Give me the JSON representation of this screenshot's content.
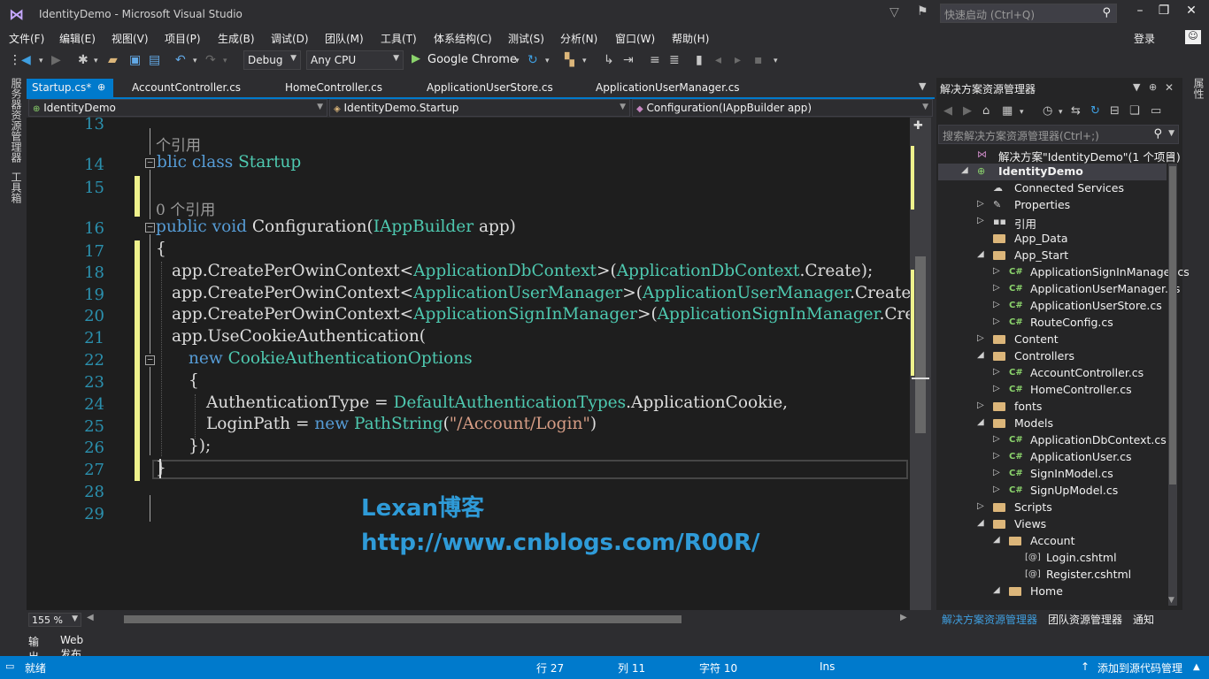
{
  "window": {
    "title": "IdentityDemo - Microsoft Visual Studio",
    "quick_launch_placeholder": "快速启动 (Ctrl+Q)",
    "login": "登录"
  },
  "menu": [
    "文件(F)",
    "编辑(E)",
    "视图(V)",
    "项目(P)",
    "生成(B)",
    "调试(D)",
    "团队(M)",
    "工具(T)",
    "体系结构(C)",
    "测试(S)",
    "分析(N)",
    "窗口(W)",
    "帮助(H)"
  ],
  "toolbar": {
    "config": "Debug",
    "platform": "Any CPU",
    "run_target": "Google Chrome"
  },
  "left_strip": {
    "server_explorer": "服务器资源管理器",
    "toolbox": "工具箱"
  },
  "right_strip": {
    "properties": "属性"
  },
  "tabs": [
    {
      "label": "Startup.cs*",
      "active": true
    },
    {
      "label": "AccountController.cs"
    },
    {
      "label": "HomeController.cs"
    },
    {
      "label": "ApplicationUserStore.cs"
    },
    {
      "label": "ApplicationUserManager.cs"
    }
  ],
  "navbar": {
    "project": "IdentityDemo",
    "type": "IdentityDemo.Startup",
    "member": "Configuration(IAppBuilder app)"
  },
  "code": {
    "line_numbers": [
      "13",
      "14",
      "15",
      "16",
      "17",
      "18",
      "19",
      "20",
      "21",
      "22",
      "23",
      "24",
      "25",
      "26",
      "27",
      "28",
      "29"
    ],
    "refs_a": "个引用",
    "refs_b": "0 个引用",
    "l14_kw": "blic class ",
    "l14_ty": "Startup",
    "l16_kw": "public void ",
    "l16_a": "Configuration(",
    "l16_ty": "IAppBuilder",
    "l16_b": " app)",
    "l17": "{",
    "l18_a": "app.CreatePerOwinContext<",
    "l18_t1": "ApplicationDbContext",
    "l18_b": ">(",
    "l18_t2": "ApplicationDbContext",
    "l18_c": ".Create);",
    "l19_a": "app.CreatePerOwinContext<",
    "l19_t1": "ApplicationUserManager",
    "l19_b": ">(",
    "l19_t2": "ApplicationUserManager",
    "l19_c": ".Create);",
    "l20_a": "app.CreatePerOwinContext<",
    "l20_t1": "ApplicationSignInManager",
    "l20_b": ">(",
    "l20_t2": "ApplicationSignInManager",
    "l20_c": ".Create);",
    "l21": "app.UseCookieAuthentication(",
    "l22_kw": "new ",
    "l22_ty": "CookieAuthenticationOptions",
    "l23": "{",
    "l24_a": "AuthenticationType = ",
    "l24_ty": "DefaultAuthenticationTypes",
    "l24_b": ".ApplicationCookie,",
    "l25_a": "LoginPath = ",
    "l25_kw": "new ",
    "l25_ty": "PathString",
    "l25_b": "(",
    "l25_st": "\"/Account/Login\"",
    "l25_c": ")",
    "l26": "});",
    "l27": "}"
  },
  "watermark": {
    "line1": "Lexan博客",
    "line2": "http://www.cnblogs.com/R00R/"
  },
  "zoom": "155 %",
  "bottom_tabs": [
    "输出",
    "Web 发布活动"
  ],
  "status": {
    "ready": "就绪",
    "row": "行 27",
    "col": "列 11",
    "char": "字符 10",
    "ins": "Ins",
    "source_control": "添加到源代码管理"
  },
  "solution_explorer": {
    "title": "解决方案资源管理器",
    "search_placeholder": "搜索解决方案资源管理器(Ctrl+;)",
    "tree": [
      {
        "label": "解决方案\"IdentityDemo\"(1 个项目)",
        "level": 0,
        "icon": "solution",
        "exp": ""
      },
      {
        "label": "IdentityDemo",
        "level": 0,
        "icon": "project",
        "exp": "▲",
        "bold": true,
        "sel": true
      },
      {
        "label": "Connected Services",
        "level": 1,
        "icon": "connected",
        "exp": ""
      },
      {
        "label": "Properties",
        "level": 1,
        "icon": "wrench",
        "exp": "▷"
      },
      {
        "label": "引用",
        "level": 1,
        "icon": "refs",
        "exp": "▷"
      },
      {
        "label": "App_Data",
        "level": 1,
        "icon": "folder",
        "exp": ""
      },
      {
        "label": "App_Start",
        "level": 1,
        "icon": "folder",
        "exp": "▲"
      },
      {
        "label": "ApplicationSignInManager.cs",
        "level": 2,
        "icon": "cs",
        "exp": "▷"
      },
      {
        "label": "ApplicationUserManager.cs",
        "level": 2,
        "icon": "cs",
        "exp": "▷"
      },
      {
        "label": "ApplicationUserStore.cs",
        "level": 2,
        "icon": "cs",
        "exp": "▷"
      },
      {
        "label": "RouteConfig.cs",
        "level": 2,
        "icon": "cs",
        "exp": "▷"
      },
      {
        "label": "Content",
        "level": 1,
        "icon": "folder",
        "exp": "▷"
      },
      {
        "label": "Controllers",
        "level": 1,
        "icon": "folder",
        "exp": "▲"
      },
      {
        "label": "AccountController.cs",
        "level": 2,
        "icon": "cs",
        "exp": "▷"
      },
      {
        "label": "HomeController.cs",
        "level": 2,
        "icon": "cs",
        "exp": "▷"
      },
      {
        "label": "fonts",
        "level": 1,
        "icon": "folder",
        "exp": "▷"
      },
      {
        "label": "Models",
        "level": 1,
        "icon": "folder",
        "exp": "▲"
      },
      {
        "label": "ApplicationDbContext.cs",
        "level": 2,
        "icon": "cs",
        "exp": "▷"
      },
      {
        "label": "ApplicationUser.cs",
        "level": 2,
        "icon": "cs",
        "exp": "▷"
      },
      {
        "label": "SignInModel.cs",
        "level": 2,
        "icon": "cs",
        "exp": "▷"
      },
      {
        "label": "SignUpModel.cs",
        "level": 2,
        "icon": "cs",
        "exp": "▷"
      },
      {
        "label": "Scripts",
        "level": 1,
        "icon": "folder",
        "exp": "▷"
      },
      {
        "label": "Views",
        "level": 1,
        "icon": "folder",
        "exp": "▲"
      },
      {
        "label": "Account",
        "level": 2,
        "icon": "folder",
        "exp": "▲"
      },
      {
        "label": "Login.cshtml",
        "level": 3,
        "icon": "cshtml",
        "exp": ""
      },
      {
        "label": "Register.cshtml",
        "level": 3,
        "icon": "cshtml",
        "exp": ""
      },
      {
        "label": "Home",
        "level": 2,
        "icon": "folder",
        "exp": "▲"
      }
    ],
    "bottom_tabs": [
      {
        "label": "解决方案资源管理器",
        "active": true
      },
      {
        "label": "团队资源管理器"
      },
      {
        "label": "通知"
      }
    ]
  },
  "colors": {
    "accent": "#007acc",
    "keyword": "#569cd6",
    "type": "#4ec9b0",
    "string": "#d69d85",
    "line_number": "#2b91af",
    "change_bar": "#eff28c",
    "watermark": "#2f9bd8"
  }
}
